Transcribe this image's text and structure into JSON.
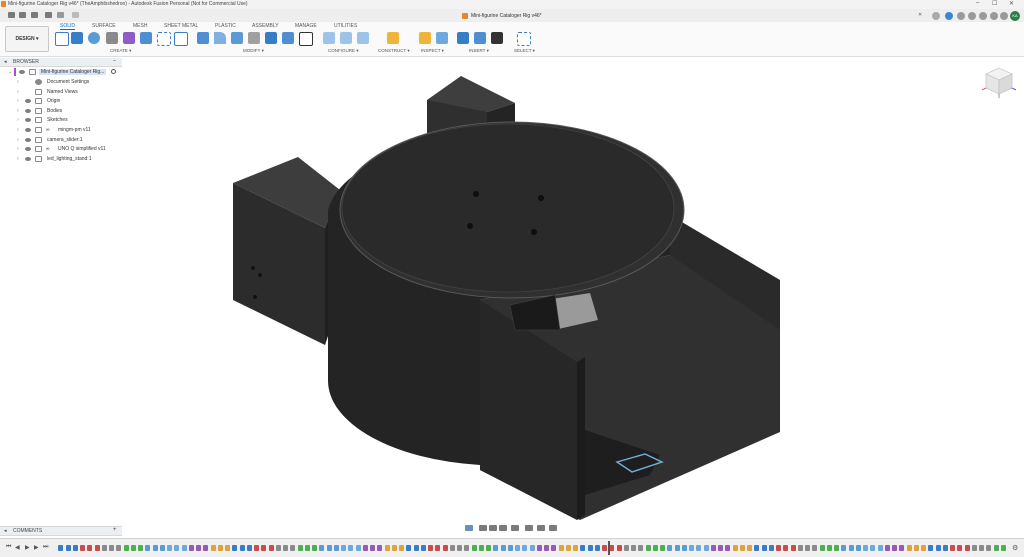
{
  "window": {
    "title": "Mini-figurine Cataloger Rig v46* (TheAmphibshedron) - Autodesk Fusion Personal (Not for Commercial Use)",
    "controls": {
      "minimize": "–",
      "maximize": "☐",
      "close": "✕"
    }
  },
  "document_tab": {
    "label": "Mini-figurine Cataloger Rig v46*",
    "close_label": "✕"
  },
  "user": {
    "initials": "KA",
    "avatar_color": "#2d7d46"
  },
  "workspace": {
    "mode_label": "DESIGN ▾"
  },
  "ribbon": {
    "tabs": [
      "SOLID",
      "SURFACE",
      "MESH",
      "SHEET METAL",
      "PLASTIC",
      "ASSEMBLY",
      "MANAGE",
      "UTILITIES"
    ],
    "active_tab": "SOLID",
    "groups": [
      "CREATE ▾",
      "MODIFY ▾",
      "CONFIGURE ▾",
      "CONSTRUCT ▾",
      "INSPECT ▾",
      "INSERT ▾",
      "SELECT ▾"
    ]
  },
  "browser": {
    "title": "BROWSER",
    "root": "Mini-figurine Cataloger Rig...",
    "items": [
      {
        "label": "Document Settings",
        "icon": "gear-icon",
        "eye": false,
        "link": false
      },
      {
        "label": "Named Views",
        "icon": "folder-icon",
        "eye": false,
        "link": false
      },
      {
        "label": "Origin",
        "icon": "folder-icon",
        "eye": true,
        "link": false
      },
      {
        "label": "Bodies",
        "icon": "folder-icon",
        "eye": true,
        "link": false
      },
      {
        "label": "Sketches",
        "icon": "folder-icon",
        "eye": true,
        "link": false
      },
      {
        "label": "mingm-pm v11",
        "icon": "component-icon",
        "eye": true,
        "link": true
      },
      {
        "label": "camera_slider:1",
        "icon": "component-icon",
        "eye": true,
        "link": false
      },
      {
        "label": "UNO Q simplified v11",
        "icon": "component-icon",
        "eye": true,
        "link": true
      },
      {
        "label": "led_lighting_stand:1",
        "icon": "component-icon",
        "eye": true,
        "link": false
      }
    ]
  },
  "comments": {
    "title": "COMMENTS",
    "add_label": "+"
  },
  "colors": {
    "accent": "#0b6ec8",
    "model_dark": "#2a2a2a",
    "model_mid": "#3a3a3a",
    "model_light": "#4a4a4a",
    "ribbon_bg": "#fafafa"
  }
}
